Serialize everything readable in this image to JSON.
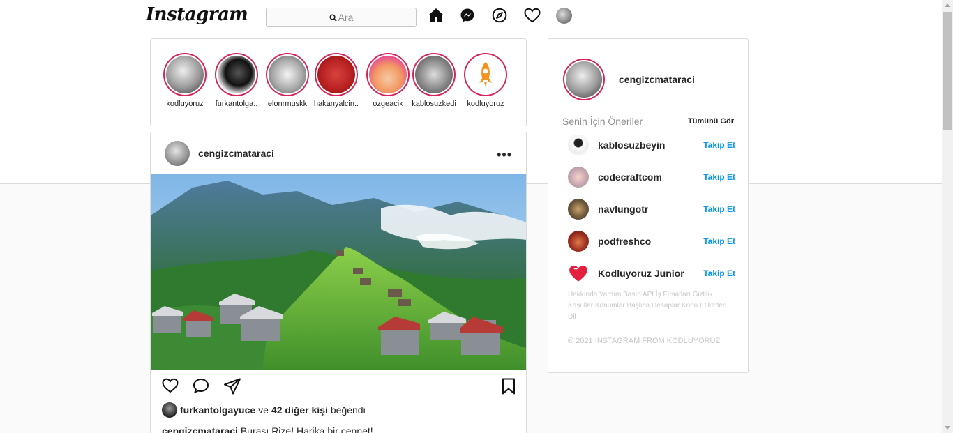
{
  "header": {
    "logo": "Instagram",
    "search_placeholder": "Ara"
  },
  "stories": [
    {
      "name": "kodluyoruz"
    },
    {
      "name": "furkantolga.."
    },
    {
      "name": "elonrmuskk"
    },
    {
      "name": "hakanyalcin.."
    },
    {
      "name": "ozgeacik"
    },
    {
      "name": "kablosuzkedi"
    },
    {
      "name": "kodluyoruz"
    }
  ],
  "post": {
    "username": "cengizcmataraci",
    "more": "•••",
    "liked_by_user": "furkantolgayuce",
    "liked_by_connector": "ve",
    "liked_by_others": "42 diğer kişi",
    "liked_by_suffix": "beğendi",
    "caption_user": "cengizcmataraci",
    "caption_text": "Burası Rize! Harika bir cennet!"
  },
  "sidebar": {
    "username": "cengizcmataraci",
    "suggestions_title": "Senin İçin Öneriler",
    "see_all": "Tümünü Gör",
    "suggestions": [
      {
        "name": "kablosuzbeyin",
        "action": "Takip Et"
      },
      {
        "name": "codecraftcom",
        "action": "Takip Et"
      },
      {
        "name": "navlungotr",
        "action": "Takip Et"
      },
      {
        "name": "podfreshco",
        "action": "Takip Et"
      },
      {
        "name": "Kodluyoruz Junior",
        "action": "Takip Et"
      }
    ],
    "footer_links": "Hakkında Yardım Basın API İş Fırsatları Gizlilik Koşullar Konumlar Başlıca Hesaplar Konu Etiketleri Dil",
    "copyright": "© 2021 INSTAGRAM FROM KODLUYORUZ"
  },
  "colors": {
    "story_ring": "#d6245a",
    "follow_link": "#0095f6",
    "border": "#dbdbdb"
  }
}
